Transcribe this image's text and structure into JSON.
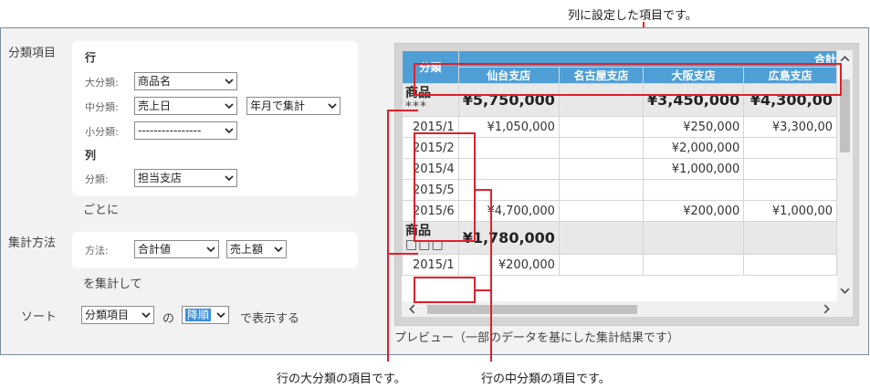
{
  "callouts": {
    "top": "列に設定した項目です。",
    "bottom_left": "行の大分類の項目です。",
    "bottom_right": "行の中分類の項目です。"
  },
  "settings": {
    "section_label": "分類項目",
    "row_heading": "行",
    "major_label": "大分類:",
    "major_value": "商品名",
    "middle_label": "中分類:",
    "middle_value": "売上日",
    "middle_agg_value": "年月で集計",
    "minor_label": "小分類:",
    "minor_value": "----------------",
    "col_heading": "列",
    "col_label": "分類:",
    "col_value": "担当支店",
    "per_text": "ごとに",
    "method_section_label": "集計方法",
    "method_label": "方法:",
    "method_value": "合計値",
    "method_field_value": "売上額",
    "aggregate_text": "を集計して",
    "sort_section_label": "ソート",
    "sort_field_value": "分類項目",
    "sort_of_text": "の",
    "sort_order_value": "降順",
    "sort_display_text": "で表示する"
  },
  "preview": {
    "caption": "プレビュー（一部のデータを基にした集計結果です）",
    "header_category": "分類",
    "header_total": "合計",
    "columns": [
      "仙台支店",
      "名古屋支店",
      "大阪支店",
      "広島支店"
    ],
    "groups": [
      {
        "name": "商品",
        "sub": "***",
        "totals": [
          "¥5,750,000",
          "",
          "¥3,450,000",
          "¥4,300,00"
        ],
        "rows": [
          {
            "date": "2015/1",
            "values": [
              "¥1,050,000",
              "",
              "¥250,000",
              "¥3,300,00"
            ]
          },
          {
            "date": "2015/2",
            "values": [
              "",
              "",
              "¥2,000,000",
              ""
            ]
          },
          {
            "date": "2015/4",
            "values": [
              "",
              "",
              "¥1,000,000",
              ""
            ]
          },
          {
            "date": "2015/5",
            "values": [
              "",
              "",
              "",
              ""
            ]
          },
          {
            "date": "2015/6",
            "values": [
              "¥4,700,000",
              "",
              "¥200,000",
              "¥1,000,00"
            ]
          }
        ]
      },
      {
        "name": "商品",
        "sub": "□□□",
        "totals": [
          "¥1,780,000",
          "",
          "",
          ""
        ],
        "rows": [
          {
            "date": "2015/1",
            "values": [
              "¥200,000",
              "",
              "",
              ""
            ]
          }
        ]
      }
    ]
  },
  "colors": {
    "header_blue": "#4f9fd6",
    "highlight_red": "#e0202a",
    "group_row_gray": "#e8e8e8"
  }
}
